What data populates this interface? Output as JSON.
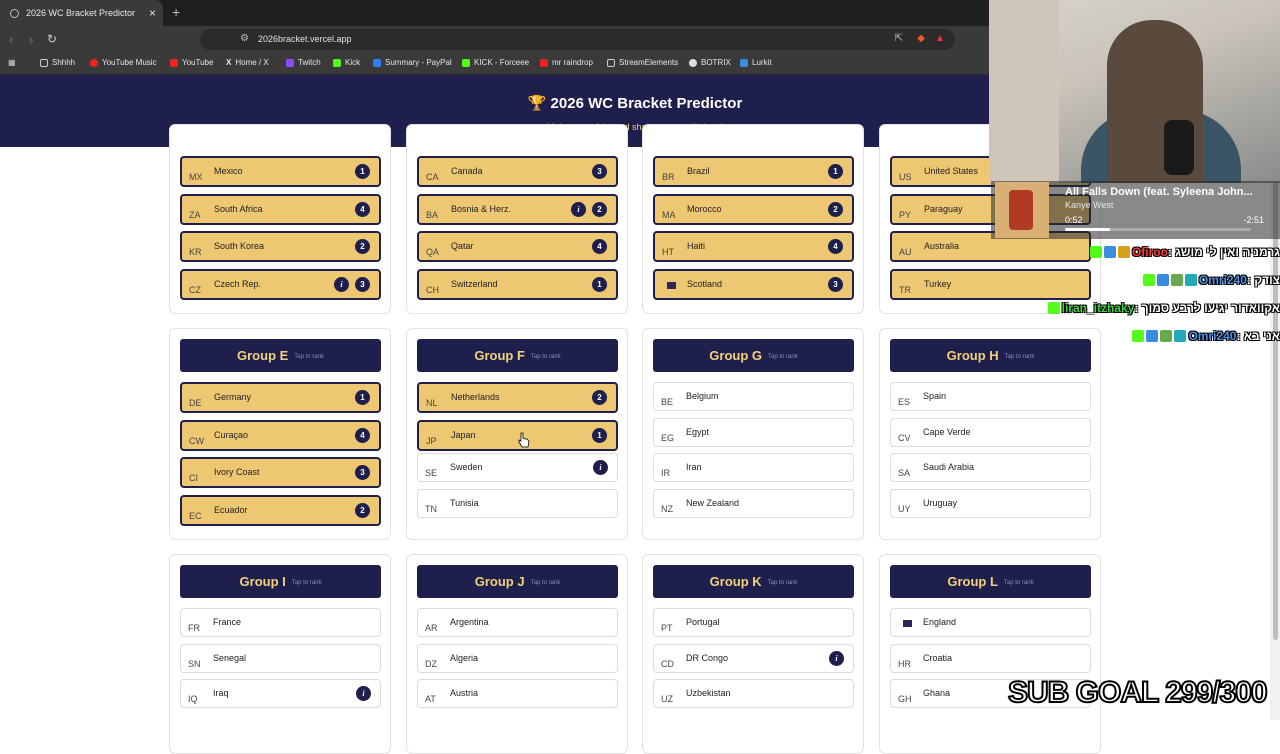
{
  "browser": {
    "tab_title": "2026 WC Bracket Predictor",
    "url": "2026bracket.vercel.app",
    "bookmarks": [
      "Shhhh",
      "YouTube Music",
      "YouTube",
      "Home / X",
      "Twitch",
      "Kick",
      "Summary - PayPal",
      "KICK - Forceee",
      "mr raindrop",
      "StreamElements",
      "BOTRIX",
      "Lurkit"
    ]
  },
  "site": {
    "title": "🏆 2026 WC Bracket Predictor",
    "subtitle": "Make your picks and share your predictions!"
  },
  "tap_hint": "Tap to rank",
  "groups": [
    {
      "name": "",
      "teams": [
        {
          "code": "MX",
          "name": "Mexico",
          "rank": "1",
          "picked": true,
          "info": false
        },
        {
          "code": "ZA",
          "name": "South Africa",
          "rank": "4",
          "picked": true,
          "info": false
        },
        {
          "code": "KR",
          "name": "South Korea",
          "rank": "2",
          "picked": true,
          "info": false
        },
        {
          "code": "CZ",
          "name": "Czech Rep.",
          "rank": "3",
          "picked": true,
          "info": true
        }
      ]
    },
    {
      "name": "",
      "teams": [
        {
          "code": "CA",
          "name": "Canada",
          "rank": "3",
          "picked": true,
          "info": false
        },
        {
          "code": "BA",
          "name": "Bosnia & Herz.",
          "rank": "2",
          "picked": true,
          "info": true
        },
        {
          "code": "QA",
          "name": "Qatar",
          "rank": "4",
          "picked": true,
          "info": false
        },
        {
          "code": "CH",
          "name": "Switzerland",
          "rank": "1",
          "picked": true,
          "info": false
        }
      ]
    },
    {
      "name": "",
      "teams": [
        {
          "code": "BR",
          "name": "Brazil",
          "rank": "1",
          "picked": true,
          "info": false
        },
        {
          "code": "MA",
          "name": "Morocco",
          "rank": "2",
          "picked": true,
          "info": false
        },
        {
          "code": "HT",
          "name": "Haiti",
          "rank": "4",
          "picked": true,
          "info": false
        },
        {
          "code": "",
          "name": "Scotland",
          "rank": "3",
          "picked": true,
          "info": false,
          "flag": true
        }
      ]
    },
    {
      "name": "",
      "teams": [
        {
          "code": "US",
          "name": "United States",
          "rank": "",
          "picked": true,
          "info": false
        },
        {
          "code": "PY",
          "name": "Paraguay",
          "rank": "",
          "picked": true,
          "info": false
        },
        {
          "code": "AU",
          "name": "Australia",
          "rank": "",
          "picked": true,
          "info": false
        },
        {
          "code": "TR",
          "name": "Turkey",
          "rank": "",
          "picked": true,
          "info": false
        }
      ]
    },
    {
      "name": "Group E",
      "teams": [
        {
          "code": "DE",
          "name": "Germany",
          "rank": "1",
          "picked": true,
          "info": false
        },
        {
          "code": "CW",
          "name": "Curaçao",
          "rank": "4",
          "picked": true,
          "info": false
        },
        {
          "code": "CI",
          "name": "Ivory Coast",
          "rank": "3",
          "picked": true,
          "info": false
        },
        {
          "code": "EC",
          "name": "Ecuador",
          "rank": "2",
          "picked": true,
          "info": false
        }
      ]
    },
    {
      "name": "Group F",
      "teams": [
        {
          "code": "NL",
          "name": "Netherlands",
          "rank": "2",
          "picked": true,
          "info": false
        },
        {
          "code": "JP",
          "name": "Japan",
          "rank": "1",
          "picked": true,
          "info": false
        },
        {
          "code": "SE",
          "name": "Sweden",
          "rank": "",
          "picked": false,
          "info": true
        },
        {
          "code": "TN",
          "name": "Tunisia",
          "rank": "",
          "picked": false,
          "info": false
        }
      ]
    },
    {
      "name": "Group G",
      "teams": [
        {
          "code": "BE",
          "name": "Belgium",
          "rank": "",
          "picked": false,
          "info": false
        },
        {
          "code": "EG",
          "name": "Egypt",
          "rank": "",
          "picked": false,
          "info": false
        },
        {
          "code": "IR",
          "name": "Iran",
          "rank": "",
          "picked": false,
          "info": false
        },
        {
          "code": "NZ",
          "name": "New Zealand",
          "rank": "",
          "picked": false,
          "info": false
        }
      ]
    },
    {
      "name": "Group H",
      "teams": [
        {
          "code": "ES",
          "name": "Spain",
          "rank": "",
          "picked": false,
          "info": false
        },
        {
          "code": "CV",
          "name": "Cape Verde",
          "rank": "",
          "picked": false,
          "info": false
        },
        {
          "code": "SA",
          "name": "Saudi Arabia",
          "rank": "",
          "picked": false,
          "info": false
        },
        {
          "code": "UY",
          "name": "Uruguay",
          "rank": "",
          "picked": false,
          "info": false
        }
      ]
    },
    {
      "name": "Group I",
      "teams": [
        {
          "code": "FR",
          "name": "France",
          "rank": "",
          "picked": false,
          "info": false
        },
        {
          "code": "SN",
          "name": "Senegal",
          "rank": "",
          "picked": false,
          "info": false
        },
        {
          "code": "IQ",
          "name": "Iraq",
          "rank": "",
          "picked": false,
          "info": true
        }
      ]
    },
    {
      "name": "Group J",
      "teams": [
        {
          "code": "AR",
          "name": "Argentina",
          "rank": "",
          "picked": false,
          "info": false
        },
        {
          "code": "DZ",
          "name": "Algeria",
          "rank": "",
          "picked": false,
          "info": false
        },
        {
          "code": "AT",
          "name": "Austria",
          "rank": "",
          "picked": false,
          "info": false
        }
      ]
    },
    {
      "name": "Group K",
      "teams": [
        {
          "code": "PT",
          "name": "Portugal",
          "rank": "",
          "picked": false,
          "info": false
        },
        {
          "code": "CD",
          "name": "DR Congo",
          "rank": "",
          "picked": false,
          "info": true
        },
        {
          "code": "UZ",
          "name": "Uzbekistan",
          "rank": "",
          "picked": false,
          "info": false
        }
      ]
    },
    {
      "name": "Group L",
      "teams": [
        {
          "code": "",
          "name": "England",
          "rank": "",
          "picked": false,
          "info": false,
          "flag": true
        },
        {
          "code": "HR",
          "name": "Croatia",
          "rank": "",
          "picked": false,
          "info": false
        },
        {
          "code": "GH",
          "name": "Ghana",
          "rank": "",
          "picked": false,
          "info": false
        }
      ]
    }
  ],
  "music": {
    "song": "All Falls Down (feat. Syleena John...",
    "artist": "Kanye West",
    "elapsed": "0:52",
    "remaining": "-2:51",
    "progress": 0.24
  },
  "chat": [
    {
      "user": "Ofiroo",
      "message": "גרמניה ואין לי מושג",
      "user_color": "#ff3b3b"
    },
    {
      "user": "Omri240",
      "message": "צודק",
      "user_color": "#4a90e2"
    },
    {
      "user": "liran_itzhaky",
      "message": "אקוואדור יגיעו לרבע סמוך",
      "user_color": "#3fd13f"
    },
    {
      "user": "Omri240",
      "message": "אני בא",
      "user_color": "#4a90e2"
    }
  ],
  "sub_goal": "SUB GOAL 299/300",
  "colors": {
    "navy": "#1f1f4d",
    "gold": "#edc772",
    "accent_text": "#f2d27a"
  }
}
